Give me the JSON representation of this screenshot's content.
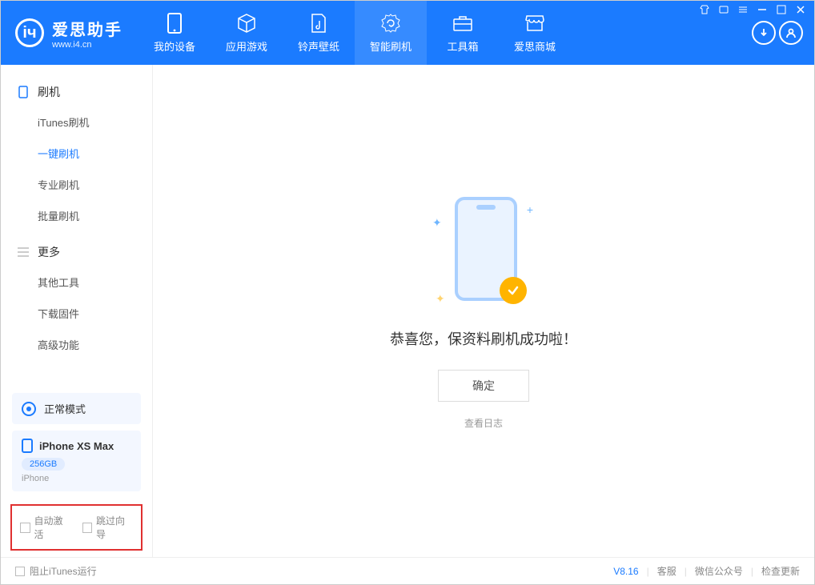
{
  "app": {
    "name": "爱思助手",
    "url": "www.i4.cn"
  },
  "nav": [
    {
      "label": "我的设备"
    },
    {
      "label": "应用游戏"
    },
    {
      "label": "铃声壁纸"
    },
    {
      "label": "智能刷机"
    },
    {
      "label": "工具箱"
    },
    {
      "label": "爱思商城"
    }
  ],
  "sidebar": {
    "section1": {
      "title": "刷机",
      "items": [
        "iTunes刷机",
        "一键刷机",
        "专业刷机",
        "批量刷机"
      ]
    },
    "section2": {
      "title": "更多",
      "items": [
        "其他工具",
        "下载固件",
        "高级功能"
      ]
    }
  },
  "mode": {
    "label": "正常模式"
  },
  "device": {
    "name": "iPhone XS Max",
    "capacity": "256GB",
    "type": "iPhone"
  },
  "bottom": {
    "opt1": "自动激活",
    "opt2": "跳过向导"
  },
  "main": {
    "headline": "恭喜您，保资料刷机成功啦！",
    "ok": "确定",
    "log": "查看日志"
  },
  "footer": {
    "block": "阻止iTunes运行",
    "version": "V8.16",
    "links": [
      "客服",
      "微信公众号",
      "检查更新"
    ]
  }
}
